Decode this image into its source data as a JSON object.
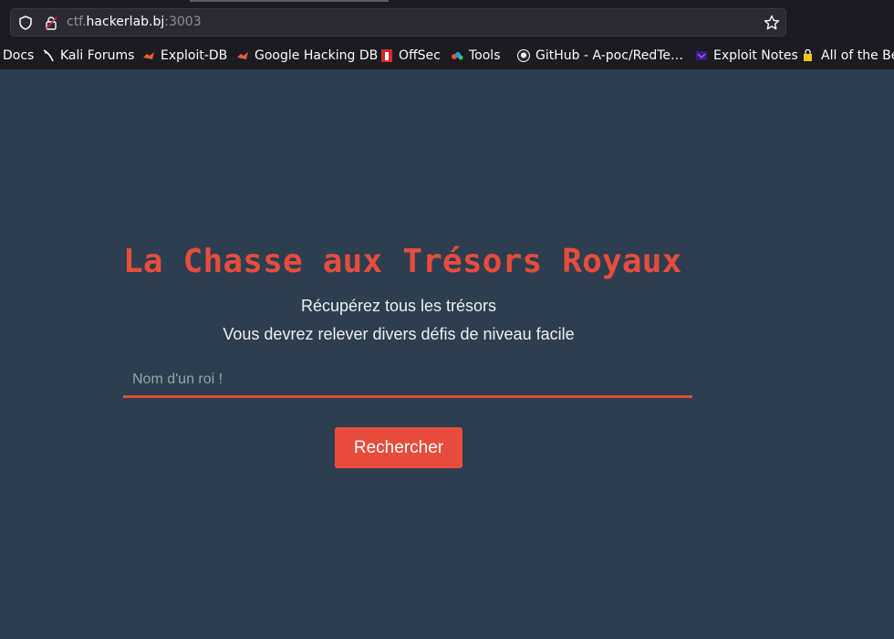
{
  "browser": {
    "url_prefix": "ctf.",
    "url_host": "hackerlab.bj",
    "url_port": ":3003",
    "bookmarks": [
      {
        "label": "Docs",
        "icon": "none"
      },
      {
        "label": "Kali Forums",
        "icon": "kali-dragon-icon"
      },
      {
        "label": "Exploit-DB",
        "icon": "exploit-db-icon"
      },
      {
        "label": "Google Hacking DB",
        "icon": "exploit-db-icon"
      },
      {
        "label": "OffSec",
        "icon": "offsec-icon"
      },
      {
        "label": "Tools",
        "icon": "tools-icon"
      },
      {
        "label": "GitHub - A-poc/RedTe…",
        "icon": "github-icon"
      },
      {
        "label": "Exploit Notes",
        "icon": "exploit-notes-icon"
      },
      {
        "label": "All of the Be",
        "icon": "lock-folder-icon"
      }
    ]
  },
  "page": {
    "title": "La Chasse aux Trésors Royaux",
    "subtitle_1": "Récupérez tous les trésors",
    "subtitle_2": "Vous devrez relever divers défis de niveau facile",
    "search_placeholder": "Nom d'un roi !",
    "search_value": "",
    "search_button": "Rechercher"
  },
  "colors": {
    "background": "#2c3e50",
    "accent": "#e74c3c",
    "text": "#ecf0f1"
  }
}
